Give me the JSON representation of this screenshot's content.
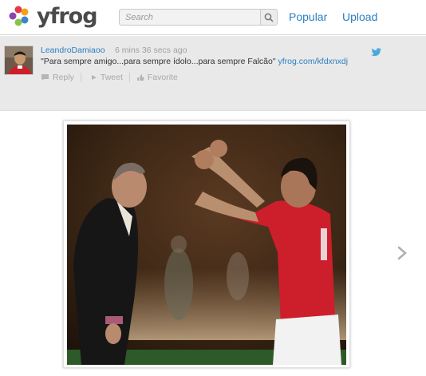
{
  "header": {
    "logo_text": "yfrog",
    "search_placeholder": "Search",
    "nav": {
      "popular": "Popular",
      "upload": "Upload"
    }
  },
  "tweet": {
    "username": "LeandroDamiaoo",
    "timestamp": "6 mins 36 secs ago",
    "text": "\"Para sempre amigo...para sempre ídolo...para sempre Falcão\"",
    "link": "yfrog.com/kfdxnxdj",
    "actions": {
      "reply": "Reply",
      "retweet": "Tweet",
      "favorite": "Favorite"
    }
  },
  "icons": {
    "search": "search-icon",
    "twitter": "twitter-bird-icon",
    "next": "chevron-right-icon",
    "reply": "reply-icon",
    "retweet": "retweet-icon",
    "favorite": "favorite-icon"
  },
  "colors": {
    "link": "#2a7fc1",
    "tweet_bg": "#e9e9e9",
    "jersey": "#cc1f2b"
  }
}
